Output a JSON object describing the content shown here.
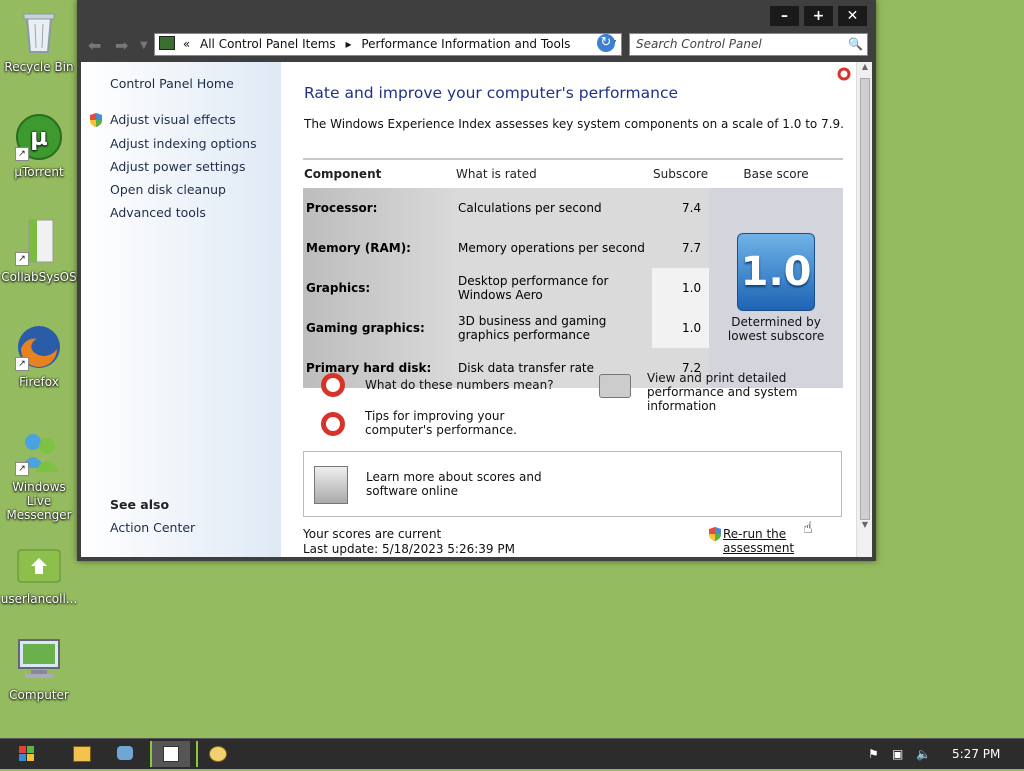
{
  "desktop": {
    "icons": [
      {
        "label": "Recycle Bin",
        "icon": "recycle-bin-icon"
      },
      {
        "label": "µTorrent",
        "icon": "utorrent-icon"
      },
      {
        "label": "CollabSysOS",
        "icon": "file-icon"
      },
      {
        "label": "Firefox",
        "icon": "firefox-icon"
      },
      {
        "label": "Windows Live Messenger",
        "icon": "messenger-icon"
      },
      {
        "label": "userlancoll...",
        "icon": "folder-icon"
      },
      {
        "label": "Computer",
        "icon": "computer-icon"
      }
    ]
  },
  "window": {
    "address": {
      "chevron": "«",
      "crumb1": "All Control Panel Items",
      "crumb2": "Performance Information and Tools"
    },
    "search": {
      "placeholder": "Search Control Panel"
    },
    "caption": {
      "minimize": "–",
      "maximize": "+",
      "close": "✕"
    }
  },
  "sidebar": {
    "home": "Control Panel Home",
    "items": [
      {
        "label": "Adjust visual effects",
        "shield": true
      },
      {
        "label": "Adjust indexing options"
      },
      {
        "label": "Adjust power settings"
      },
      {
        "label": "Open disk cleanup"
      },
      {
        "label": "Advanced tools"
      }
    ],
    "see_also_title": "See also",
    "see_also_items": [
      "Action Center"
    ]
  },
  "main": {
    "title": "Rate and improve your computer's performance",
    "subtitle": "The Windows Experience Index assesses key system components on a scale of 1.0 to 7.9.",
    "table": {
      "headers": [
        "Component",
        "What is rated",
        "Subscore",
        "Base score"
      ],
      "rows": [
        {
          "component": "Processor:",
          "rated": "Calculations per second",
          "subscore": "7.4"
        },
        {
          "component": "Memory (RAM):",
          "rated": "Memory operations per second",
          "subscore": "7.7"
        },
        {
          "component": "Graphics:",
          "rated": "Desktop performance for Windows Aero",
          "subscore": "1.0"
        },
        {
          "component": "Gaming graphics:",
          "rated": "3D business and gaming graphics performance",
          "subscore": "1.0"
        },
        {
          "component": "Primary hard disk:",
          "rated": "Disk data transfer rate",
          "subscore": "7.2"
        }
      ],
      "base_score": "1.0",
      "base_caption": "Determined by lowest subscore"
    },
    "help": {
      "numbers": "What do these numbers mean?",
      "tips": "Tips for improving your computer's performance.",
      "print": "View and print detailed performance and system information"
    },
    "learn_more": "Learn more about scores and software online",
    "status": "Your scores are current",
    "last_update": "Last update: 5/18/2023 5:26:39 PM",
    "rerun": "Re-run the assessment"
  },
  "taskbar": {
    "clock": "5:27 PM"
  }
}
